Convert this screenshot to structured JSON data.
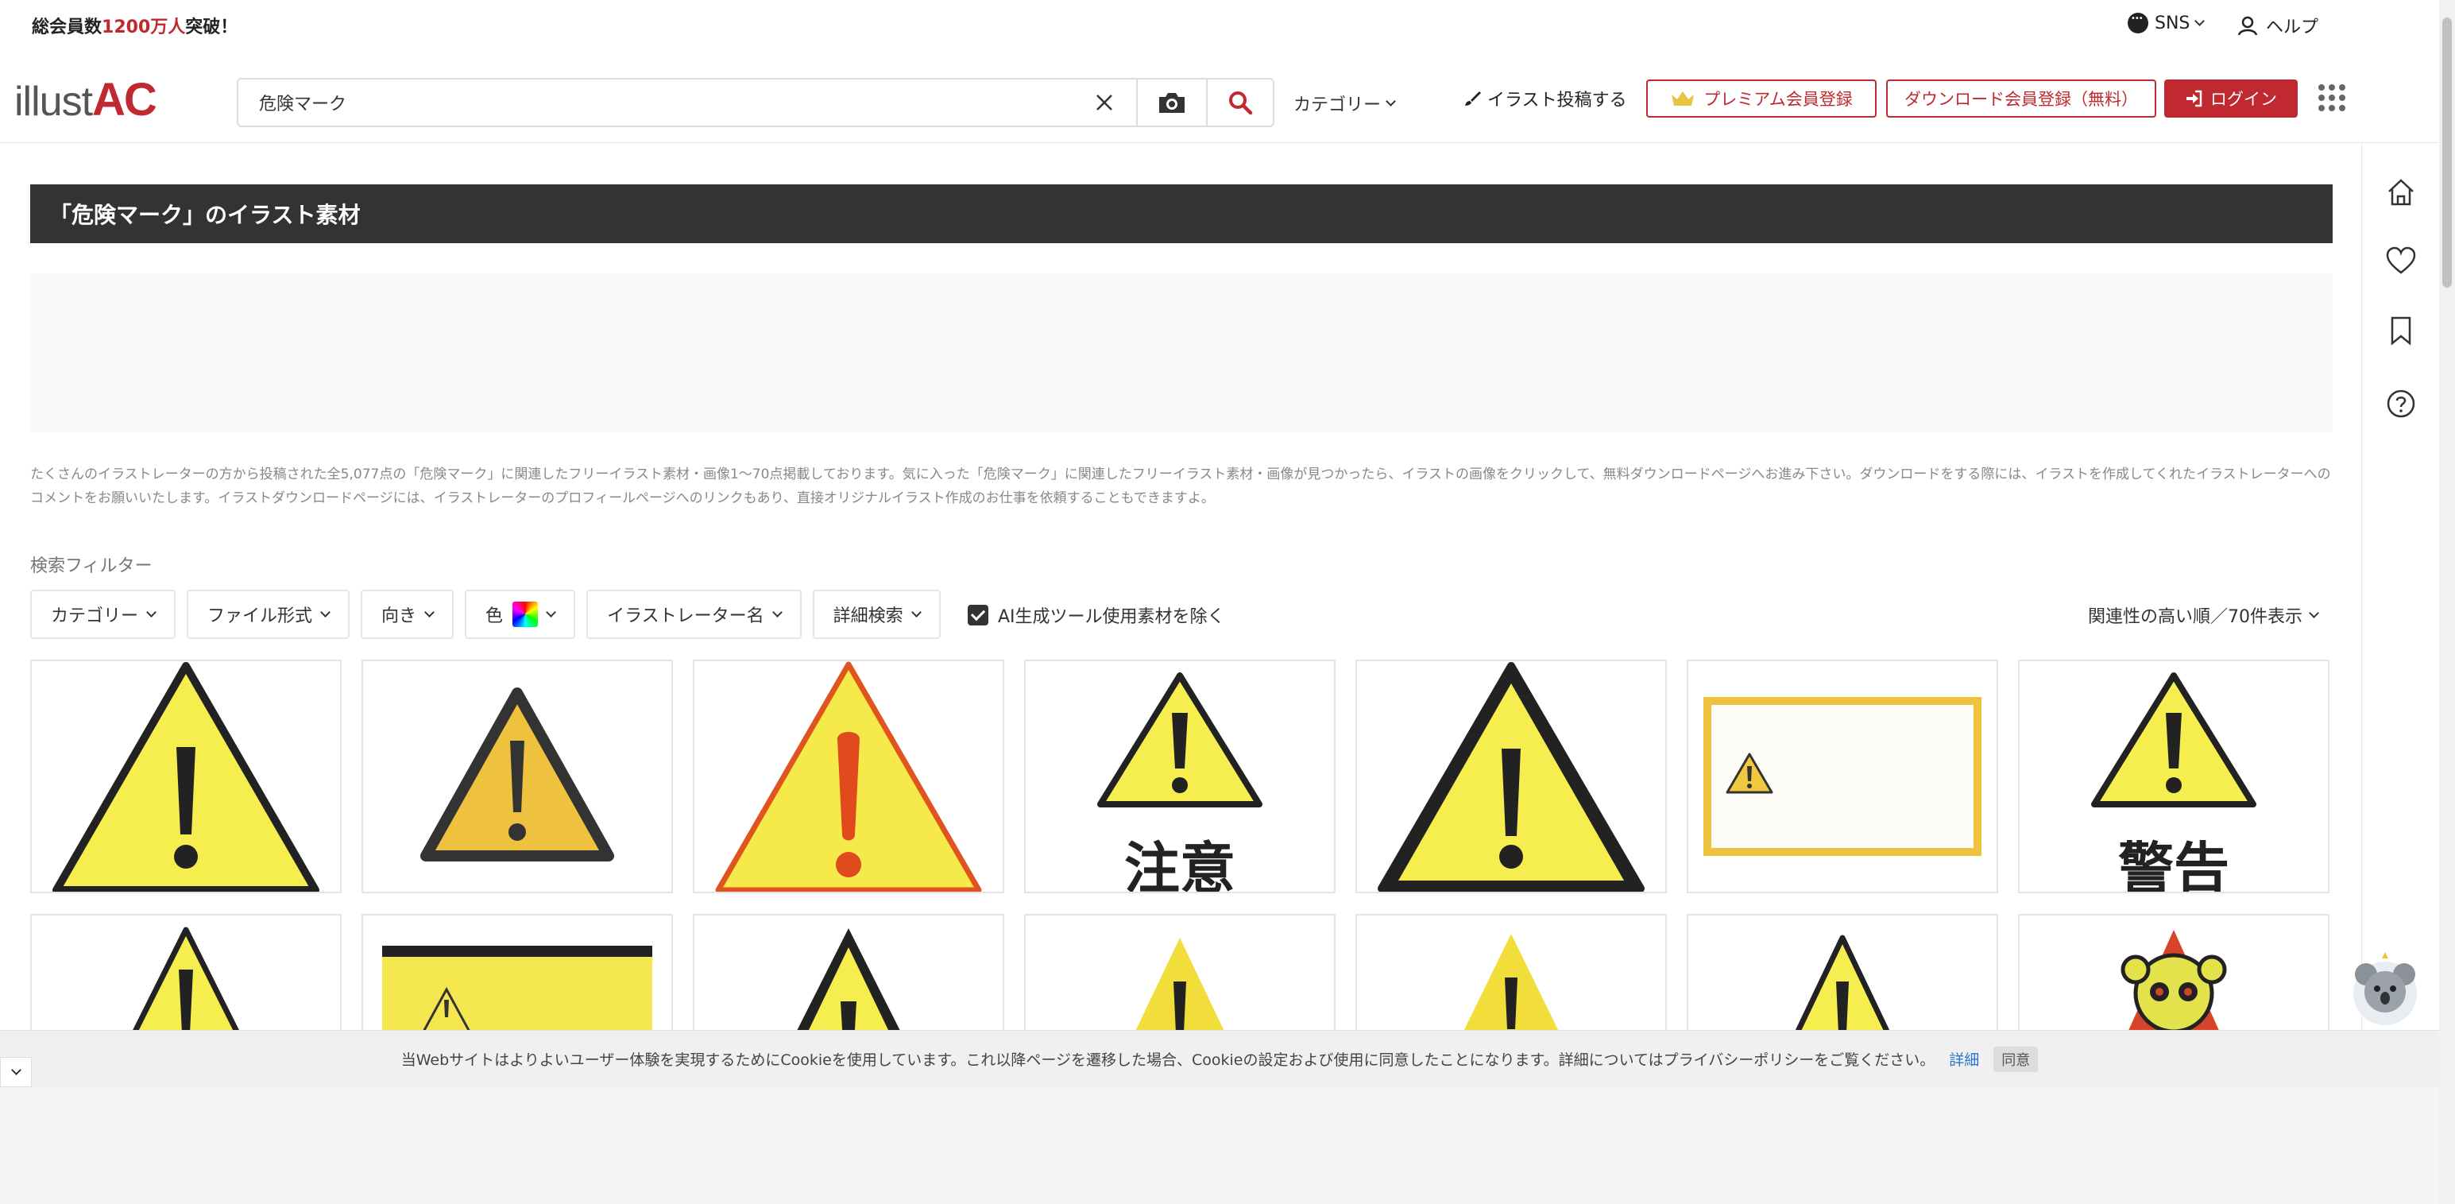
{
  "topbar": {
    "member_prefix": "総会員数",
    "member_count": "1200万人",
    "member_suffix": "突破！",
    "sns_label": "SNS",
    "help_label": "ヘルプ"
  },
  "header": {
    "logo_illust": "illust",
    "logo_ac": "AC",
    "search_value": "危険マーク",
    "category_label": "カテゴリー",
    "post_label": "イラスト投稿する",
    "premium_label": "プレミアム会員登録",
    "download_label": "ダウンロード会員登録（無料）",
    "login_label": "ログイン"
  },
  "main": {
    "title": "「危険マーク」のイラスト素材",
    "description": "たくさんのイラストレーターの方から投稿された全5,077点の「危険マーク」に関連したフリーイラスト素材・画像1〜70点掲載しております。気に入った「危険マーク」に関連したフリーイラスト素材・画像が見つかったら、イラストの画像をクリックして、無料ダウンロードページへお進み下さい。ダウンロードをする際には、イラストを作成してくれたイラストレーターへのコメントをお願いいたします。イラストダウンロードページには、イラストレーターのプロフィールページへのリンクもあり、直接オリジナルイラスト作成のお仕事を依頼することもできますよ。",
    "filter_label": "検索フィルター",
    "filters": {
      "category": "カテゴリー",
      "file_format": "ファイル形式",
      "orientation": "向き",
      "color": "色",
      "illustrator": "イラストレーター名",
      "advanced": "詳細検索"
    },
    "ai_exclude_label": "AI生成ツール使用素材を除く",
    "sort_label": "関連性の高い順／70件表示"
  },
  "cards": [
    {
      "text": ""
    },
    {
      "text": ""
    },
    {
      "text": ""
    },
    {
      "text": "注意"
    },
    {
      "text": ""
    },
    {
      "text": ""
    },
    {
      "text": "警告"
    },
    {
      "text": ""
    },
    {
      "text": ""
    },
    {
      "text": ""
    },
    {
      "text": ""
    },
    {
      "text": ""
    },
    {
      "text": ""
    },
    {
      "text": ""
    }
  ],
  "cookie": {
    "message": "当Webサイトはよりよいユーザー体験を実現するためにCookieを使用しています。これ以降ページを遷移した場合、Cookieの設定および使用に同意したことになります。詳細についてはプライバシーポリシーをご覧ください。",
    "detail_link": "詳細",
    "agree_label": "同意"
  },
  "colors": {
    "brand_red": "#c0292f",
    "title_bar": "#333333",
    "warning_yellow": "#f5ea4a"
  }
}
